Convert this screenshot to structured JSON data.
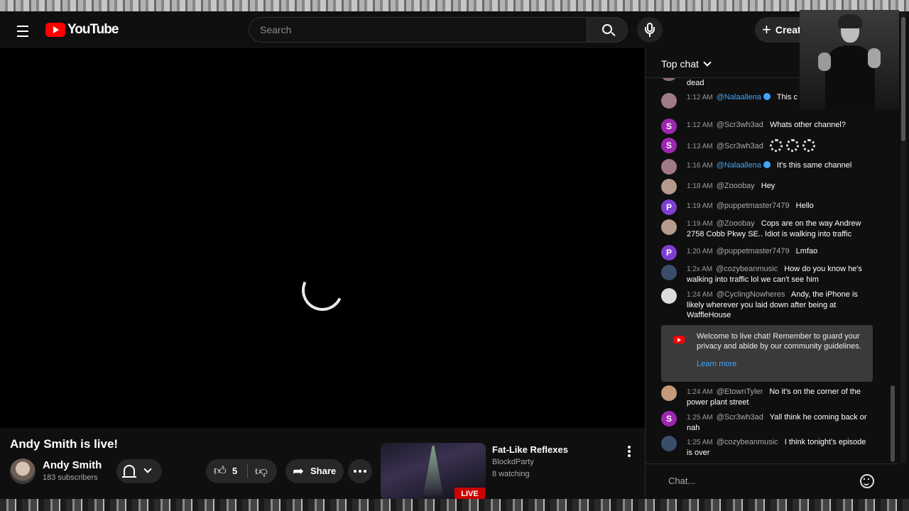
{
  "masthead": {
    "logo_text": "YouTube",
    "search_placeholder": "Search",
    "create_label": "Create"
  },
  "video": {
    "title": "Andy Smith is live!",
    "channel_name": "Andy Smith",
    "subscribers": "183 subscribers",
    "like_count": "5",
    "share_label": "Share"
  },
  "recommendation": {
    "title": "Fat-Like Reflexes",
    "channel": "BlockdParty",
    "watching": "8 watching",
    "badge": "LIVE"
  },
  "chat": {
    "mode_label": "Top chat",
    "input_placeholder": "Chat...",
    "messages": [
      {
        "time": "",
        "author": "",
        "text": "dead",
        "avatar_letter": "",
        "avatar_color": "#8a6f6f"
      },
      {
        "time": "1:12 AM",
        "author": "@Nalaallena",
        "text": "This c a circle",
        "avatar_letter": "",
        "avatar_color": "#a07a86",
        "verified": true
      },
      {
        "time": "1:12 AM",
        "author": "@Scr3wh3ad",
        "text": "Whats other channel?",
        "avatar_letter": "S",
        "avatar_color": "#9c27b0"
      },
      {
        "time": "1:13 AM",
        "author": "@Scr3wh3ad",
        "text": "",
        "avatar_letter": "S",
        "avatar_color": "#9c27b0"
      },
      {
        "time": "1:16 AM",
        "author": "@Nalaallena",
        "text": "It's this same channel",
        "avatar_letter": "",
        "avatar_color": "#a07a86",
        "verified": true
      },
      {
        "time": "1:18 AM",
        "author": "@Zooobay",
        "text": "Hey",
        "avatar_letter": "",
        "avatar_color": "#b49b8c"
      },
      {
        "time": "1:19 AM",
        "author": "@puppetmaster7479",
        "text": "Hello",
        "avatar_letter": "P",
        "avatar_color": "#7e3fd1"
      },
      {
        "time": "1:19 AM",
        "author": "@Zooobay",
        "text": "Cops are on the way Andrew 2758 Cobb Pkwy SE.. Idiot is walking into traffic",
        "avatar_letter": "",
        "avatar_color": "#b49b8c"
      },
      {
        "time": "1:20 AM",
        "author": "@puppetmaster7479",
        "text": "Lmfao",
        "avatar_letter": "P",
        "avatar_color": "#7e3fd1"
      },
      {
        "time": "1:2x AM",
        "author": "@cozybeanmusic",
        "text": "How do you know he's walking into traffic lol we can't see him",
        "avatar_letter": "",
        "avatar_color": "#3a4d6a"
      },
      {
        "time": "1:24 AM",
        "author": "@CyclingNowheres",
        "text": "Andy, the iPhone is likely wherever you laid down after being at WaffleHouse",
        "avatar_letter": "",
        "avatar_color": "#dcdcdc"
      },
      {
        "time": "1:24 AM",
        "author": "@EtownTyler",
        "text": "No it's on the corner of the power plant street",
        "avatar_letter": "",
        "avatar_color": "#c49a7a"
      },
      {
        "time": "1:25 AM",
        "author": "@Scr3wh3ad",
        "text": "Yall think he coming back or nah",
        "avatar_letter": "S",
        "avatar_color": "#9c27b0"
      },
      {
        "time": "1:25 AM",
        "author": "@cozybeanmusic",
        "text": "I think tonight's episode is over",
        "avatar_letter": "",
        "avatar_color": "#3a4d6a"
      }
    ],
    "banner": {
      "text": "Welcome to live chat! Remember to guard your privacy and abide by our community guidelines.",
      "link": "Learn more"
    }
  },
  "colors": {
    "brand_red": "#ff0000",
    "link_blue": "#3ea6ff",
    "background": "#0f0f0f"
  }
}
